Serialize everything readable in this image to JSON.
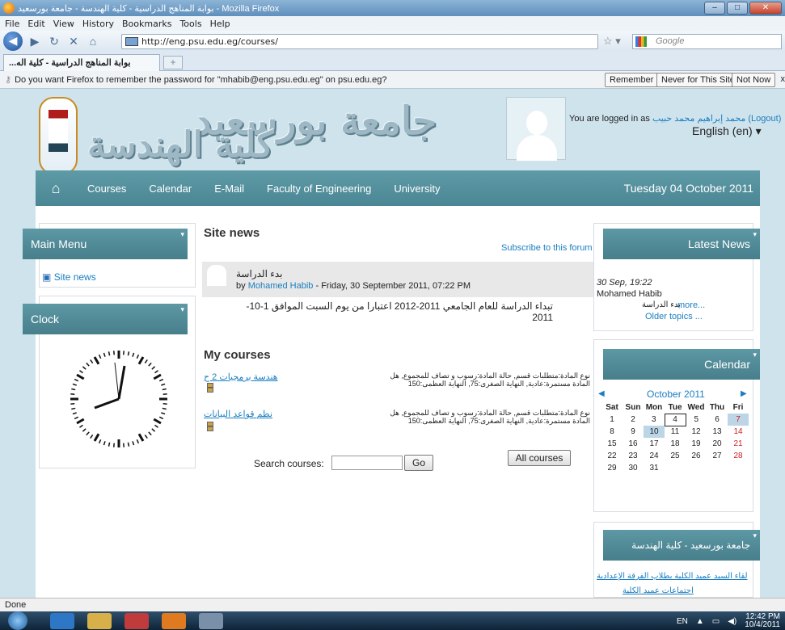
{
  "browser": {
    "window_title": "بوابة المناهج الدراسية - كلية الهندسة - جامعة بورسعيد - Mozilla Firefox",
    "menu": [
      "File",
      "Edit",
      "View",
      "History",
      "Bookmarks",
      "Tools",
      "Help"
    ],
    "url": "http://eng.psu.edu.eg/courses/",
    "search_placeholder": "Google",
    "tab_title": "...بوابة المناهج الدراسية - كلية اله",
    "password_prompt": "Do you want Firefox to remember the password for \"mhabib@eng.psu.edu.eg\" on psu.edu.eg?",
    "pw_buttons": {
      "remember": "Remember",
      "never": "Never for This Site",
      "not_now": "Not Now"
    },
    "status": "Done"
  },
  "header": {
    "title_line1": "جامعة بورسعيد",
    "title_line2": "كلية الهندسة",
    "logged_prefix": "You are logged in as",
    "user": "محمد إبراهيم محمد حبيب",
    "logout": "(Logout)",
    "language": "English (en)"
  },
  "nav": {
    "items": [
      "Courses",
      "Calendar",
      "E-Mail",
      "Faculty of Engineering",
      "University"
    ],
    "date": "Tuesday 04 October 2011"
  },
  "left": {
    "main_menu": "Main Menu",
    "site_news": "Site news",
    "clock": "Clock"
  },
  "center": {
    "site_news_title": "Site news",
    "subscribe": "Subscribe to this forum",
    "post_title": "بدء الدراسة",
    "post_by_prefix": "by",
    "post_author": "Mohamed Habib",
    "post_date": "- Friday, 30 September 2011, 07:22 PM",
    "post_body": "تبداء الدراسة للعام الجامعي 2011-2012 اعتبارا من يوم السبت الموافق 1-10-2011",
    "my_courses": "My courses",
    "courses": [
      {
        "name": "هندسة برمجيات 2 ح",
        "desc": "نوع المادة:متطلبات قسم, حالة المادة:رسوب و تصاف للمجموع, هل المادة مستمرة:عادية, النهاية الصغرى:75, النهاية العظمى:150"
      },
      {
        "name": "نظم قواعد البيانات",
        "desc": "نوع المادة:متطلبات قسم, حالة المادة:رسوب و تصاف للمجموع, هل المادة مستمرة:عادية, النهاية الصغرى:75, النهاية العظمى:150"
      }
    ],
    "search_label": "Search courses:",
    "go": "Go",
    "all_courses": "All courses"
  },
  "right": {
    "latest_news": "Latest News",
    "news_date": "30 Sep, 19:22",
    "news_author": "Mohamed Habib",
    "news_title": "بدء الدراسة",
    "news_more": "more...",
    "older_topics": "Older topics ...",
    "calendar": "Calendar",
    "month": "October 2011",
    "weekdays": [
      "Sat",
      "Sun",
      "Mon",
      "Tue",
      "Wed",
      "Thu",
      "Fri"
    ],
    "weeks": [
      [
        "1",
        "2",
        "3",
        "4",
        "5",
        "6",
        "7"
      ],
      [
        "8",
        "9",
        "10",
        "11",
        "12",
        "13",
        "14"
      ],
      [
        "15",
        "16",
        "17",
        "18",
        "19",
        "20",
        "21"
      ],
      [
        "22",
        "23",
        "24",
        "25",
        "26",
        "27",
        "28"
      ],
      [
        "29",
        "30",
        "31",
        "",
        "",
        "",
        ""
      ]
    ],
    "uni_block": "جامعة بورسعيد - كلية الهندسة",
    "uni_links": [
      "لقاء السيد عميد الكلية بطلاب الفرقة الإعدادية",
      "اجتماعات عميد الكلية"
    ]
  },
  "tray": {
    "lang": "EN",
    "time": "12:42 PM",
    "date": "10/4/2011"
  },
  "colors": {
    "teal": "#4a8693",
    "link": "#1a7ec0",
    "page_bg": "#cfe3ec"
  }
}
